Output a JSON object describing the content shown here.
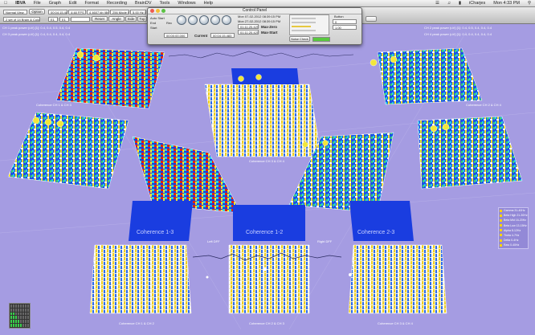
{
  "menubar": {
    "app_name": "IBVA",
    "items": [
      "File",
      "Graph",
      "Edit",
      "Format",
      "Recording",
      "BrainDV",
      "Tools",
      "Windows",
      "Help"
    ],
    "user": "iCharjes",
    "clock": "Mon 4:33 PM"
  },
  "toolbar": {
    "view_select": "Normal View",
    "option_button": "Option",
    "selection_info": "2 set of 14 Brain & Colors",
    "readout_1": "00:04:15.483",
    "readout_2": "4:48 FPS",
    "readout_3": "4 4607 kb (8bit)",
    "readout_4": "256 Mode PT",
    "readout_5": "5.00 Hz Scale",
    "reset_button": "Reset",
    "angle_button": "Angle",
    "side_button": "Side",
    "top_button": "Top"
  },
  "control_panel": {
    "title": "Control Panel",
    "label_auto_start": "Auto Start",
    "label_start": "Start",
    "label_end": "End",
    "label_rec": "Rec",
    "start_time": "00:00:00.000",
    "current_label": "Current",
    "current_time": "00:04:15.483",
    "date_1": "Mon 07-02-2012 08:39:15 PM",
    "date_2": "Mon 27-02-2012 08:39:15 PM",
    "max_zero_label": "Max-Zero",
    "max_start_label": "Max-Start",
    "max_zero_value": "01:11:20.425",
    "max_start_value": "01:11:20.425",
    "button_label": "Button",
    "button_val_1": "0",
    "button_val_2": "1.00",
    "noise_check": "Noise Check"
  },
  "plots": {
    "ch1_header": "CH 1 peak power (uV) [1]: 0.4, 0.4, 0.5, 0.4, 0.4",
    "ch2_header": "CH 2 peak power (uV) [1]: 0.4, 0.5, 0.4, 0.4, 0.4",
    "ch3_header": "CH 3 peak power (uV) [1]: 0.4, 0.4, 0.4, 0.4, 0.4",
    "ch4_header": "CH 4 peak power (uV) [1]: 0.4, 0.4, 0.4, 0.4, 0.4",
    "coh_ch1_ch3": "Coherence CH 1 & CH 3",
    "coh_ch2_ch4": "Coherence CH 2 & CH 4",
    "coh_ch3_ch4": "Coherence CH 3 & CH 4",
    "coh_1_3": "Coherence 1-3",
    "coh_1_2": "Coherence 1-2",
    "coh_2_3": "Coherence 2-3",
    "left_diff": "Left DFF",
    "right_diff": "Right DFF",
    "bottom_1": "Coherence CH 1 & CH 2",
    "bottom_2": "Coherence CH 2 & CH 3",
    "bottom_3": "Coherence CH 3 & CH 4"
  },
  "legend": {
    "items": [
      "Gamma 31-40Hz",
      "Beta High 21-30Hz",
      "Beta Mid 16-20Hz",
      "Beta Low 13-15Hz",
      "Alpha 8-12Hz",
      "Theta 4-7Hz",
      "Delta 0-4Hz",
      "Raw 0-40Hz"
    ]
  },
  "colors": {
    "background": "#a59ce2",
    "plot_base": "#1a3de0",
    "peak_red": "#e02010",
    "peak_yellow": "#f0e030",
    "meter_on": "#39d04b"
  }
}
